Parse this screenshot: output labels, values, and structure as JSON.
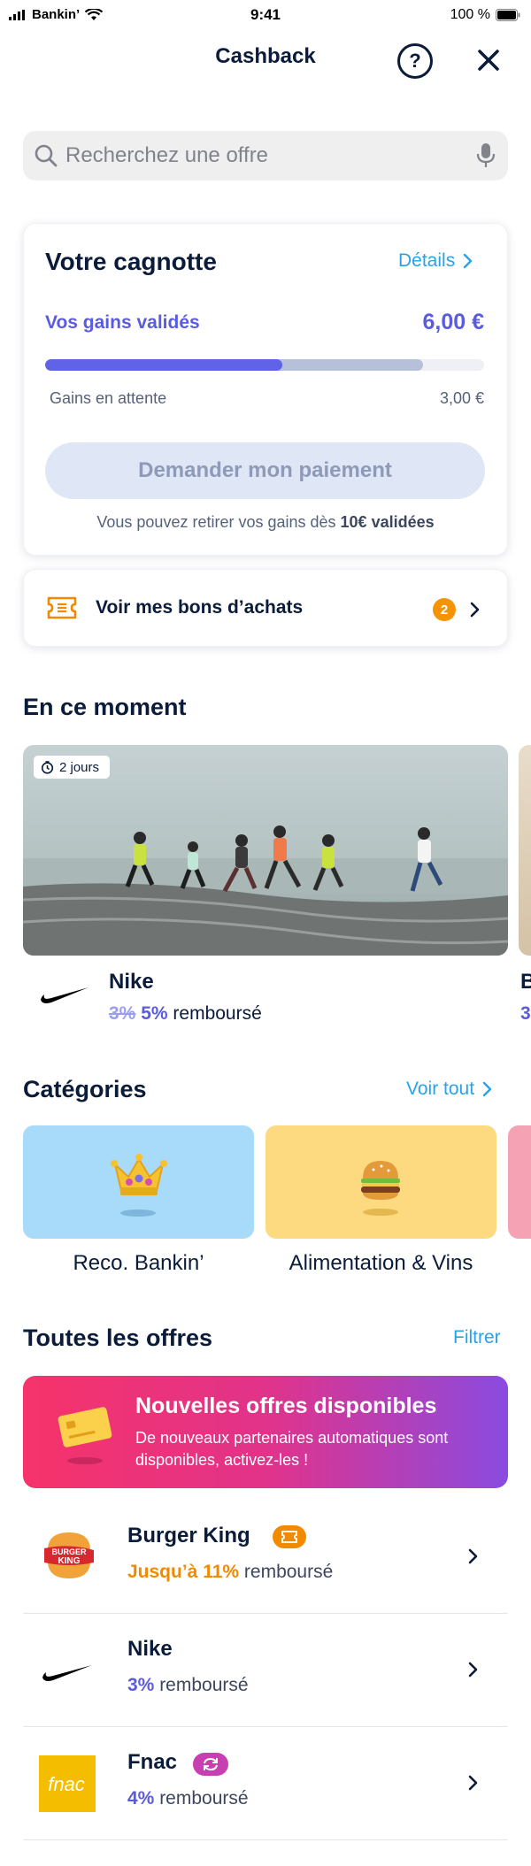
{
  "status_bar": {
    "carrier": "Bankin’",
    "time": "9:41",
    "battery": "100 %"
  },
  "header": {
    "title": "Cashback",
    "help_icon": "question-circle-icon",
    "close_icon": "close-icon"
  },
  "search": {
    "placeholder": "Recherchez une offre",
    "value": ""
  },
  "cagnotte": {
    "title": "Votre cagnotte",
    "details_label": "Détails",
    "validated_label": "Vos gains validés",
    "validated_value": "6,00 €",
    "pending_label": "Gains en attente",
    "pending_value": "3,00 €",
    "validated_progress": 0.54,
    "pending_progress": 0.86,
    "pay_button": "Demander mon paiement",
    "note_prefix": "Vous pouvez retirer vos gains dès ",
    "note_bold": "10€ validées"
  },
  "vouchers": {
    "label": "Voir mes bons d’achats",
    "count": "2"
  },
  "moment": {
    "section_title": "En ce moment",
    "timer": "2 jours",
    "brand": "Nike",
    "old_rate": "3%",
    "new_rate": "5%",
    "rate_suffix": " remboursé",
    "peek_brand": "B",
    "peek_rate": "3"
  },
  "categories": {
    "section_title": "Catégories",
    "see_all": "Voir tout",
    "items": [
      {
        "label": "Reco. Bankin’",
        "color": "#a8daf9",
        "icon": "crown-icon"
      },
      {
        "label": "Alimentation & Vins",
        "color": "#fdd97f",
        "icon": "burger-icon"
      }
    ]
  },
  "offers": {
    "section_title": "Toutes les offres",
    "filter": "Filtrer",
    "promo_title": "Nouvelles offres disponibles",
    "promo_text": "De nouveaux partenaires automatiques sont disponibles, activez-les !",
    "items": [
      {
        "name": "Burger King",
        "rate": "Jusqu’à 11%",
        "suffix": " remboursé",
        "rate_color": "#f28a00",
        "badge": "ticket-badge-icon"
      },
      {
        "name": "Nike",
        "rate": "3%",
        "suffix": " remboursé",
        "rate_color": "#5b5be0",
        "badge": ""
      },
      {
        "name": "Fnac",
        "rate": "4%",
        "suffix": " remboursé",
        "rate_color": "#5b5be0",
        "badge": "sync-badge-icon"
      }
    ]
  }
}
